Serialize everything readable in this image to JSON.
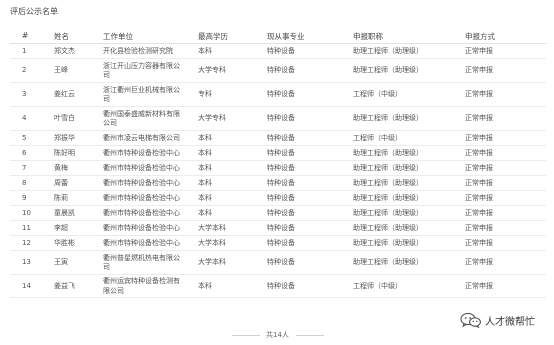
{
  "page_title": "评后公示名单",
  "columns": [
    "#",
    "姓名",
    "工作单位",
    "最高学历",
    "现从事专业",
    "申报职称",
    "申报方式"
  ],
  "rows": [
    {
      "no": "1",
      "name": "郑文杰",
      "unit": [
        "开化县检验检测研究院"
      ],
      "edu": "本科",
      "major": "特种设备",
      "title": "助理工程师（助理级）",
      "method": "正常申报"
    },
    {
      "no": "2",
      "name": "王峰",
      "unit": [
        "浙江开山压力容器有限公",
        "司"
      ],
      "edu": "大学专科",
      "major": "特种设备",
      "title": "助理工程师（助理级）",
      "method": "正常申报"
    },
    {
      "no": "3",
      "name": "姜红云",
      "unit": [
        "浙江衢州巨业机械有限公",
        "司"
      ],
      "edu": "专科",
      "major": "特种设备",
      "title": "工程师（中级）",
      "method": "正常申报"
    },
    {
      "no": "4",
      "name": "叶雪白",
      "unit": [
        "衢州国泰盛威新材料有限",
        "公司"
      ],
      "edu": "大学专科",
      "major": "特种设备",
      "title": "助理工程师（助理级）",
      "method": "正常申报"
    },
    {
      "no": "5",
      "name": "郑振华",
      "unit": [
        "衢州市凌云电梯有限公司"
      ],
      "edu": "本科",
      "major": "特种设备",
      "title": "工程师（中级）",
      "method": "正常申报"
    },
    {
      "no": "6",
      "name": "陈好明",
      "unit": [
        "衢州市特种设备检验中心"
      ],
      "edu": "本科",
      "major": "特种设备",
      "title": "助理工程师（助理级）",
      "method": "正常申报"
    },
    {
      "no": "7",
      "name": "黄梅",
      "unit": [
        "衢州市特种设备检验中心"
      ],
      "edu": "本科",
      "major": "特种设备",
      "title": "助理工程师（助理级）",
      "method": "正常申报"
    },
    {
      "no": "8",
      "name": "周蕾",
      "unit": [
        "衢州市特种设备检验中心"
      ],
      "edu": "本科",
      "major": "特种设备",
      "title": "助理工程师（助理级）",
      "method": "正常申报"
    },
    {
      "no": "9",
      "name": "陈莉",
      "unit": [
        "衢州市特种设备检验中心"
      ],
      "edu": "本科",
      "major": "特种设备",
      "title": "助理工程师（助理级）",
      "method": "正常申报"
    },
    {
      "no": "10",
      "name": "童晨凯",
      "unit": [
        "衢州市特种设备检验中心"
      ],
      "edu": "本科",
      "major": "特种设备",
      "title": "助理工程师（助理级）",
      "method": "正常申报"
    },
    {
      "no": "11",
      "name": "李超",
      "unit": [
        "衢州市特种设备检验中心"
      ],
      "edu": "大学本科",
      "major": "特种设备",
      "title": "助理工程师（助理级）",
      "method": "正常申报"
    },
    {
      "no": "12",
      "name": "华胜彬",
      "unit": [
        "衢州市特种设备检验中心"
      ],
      "edu": "大学本科",
      "major": "特种设备",
      "title": "助理工程师（助理级）",
      "method": "正常申报"
    },
    {
      "no": "13",
      "name": "王寅",
      "unit": [
        "衢州普星燃机热电有限公",
        "司"
      ],
      "edu": "大学本科",
      "major": "特种设备",
      "title": "助理工程师（助理级）",
      "method": "正常申报"
    },
    {
      "no": "14",
      "name": "姜益飞",
      "unit": [
        "衢州运宾特种设备检测有",
        "限公司"
      ],
      "edu": "本科",
      "major": "特种设备",
      "title": "工程师（中级）",
      "method": "正常申报"
    }
  ],
  "footer": "共14人",
  "watermark": {
    "text": "人才微帮忙",
    "icon": "wechat-logo-icon"
  }
}
